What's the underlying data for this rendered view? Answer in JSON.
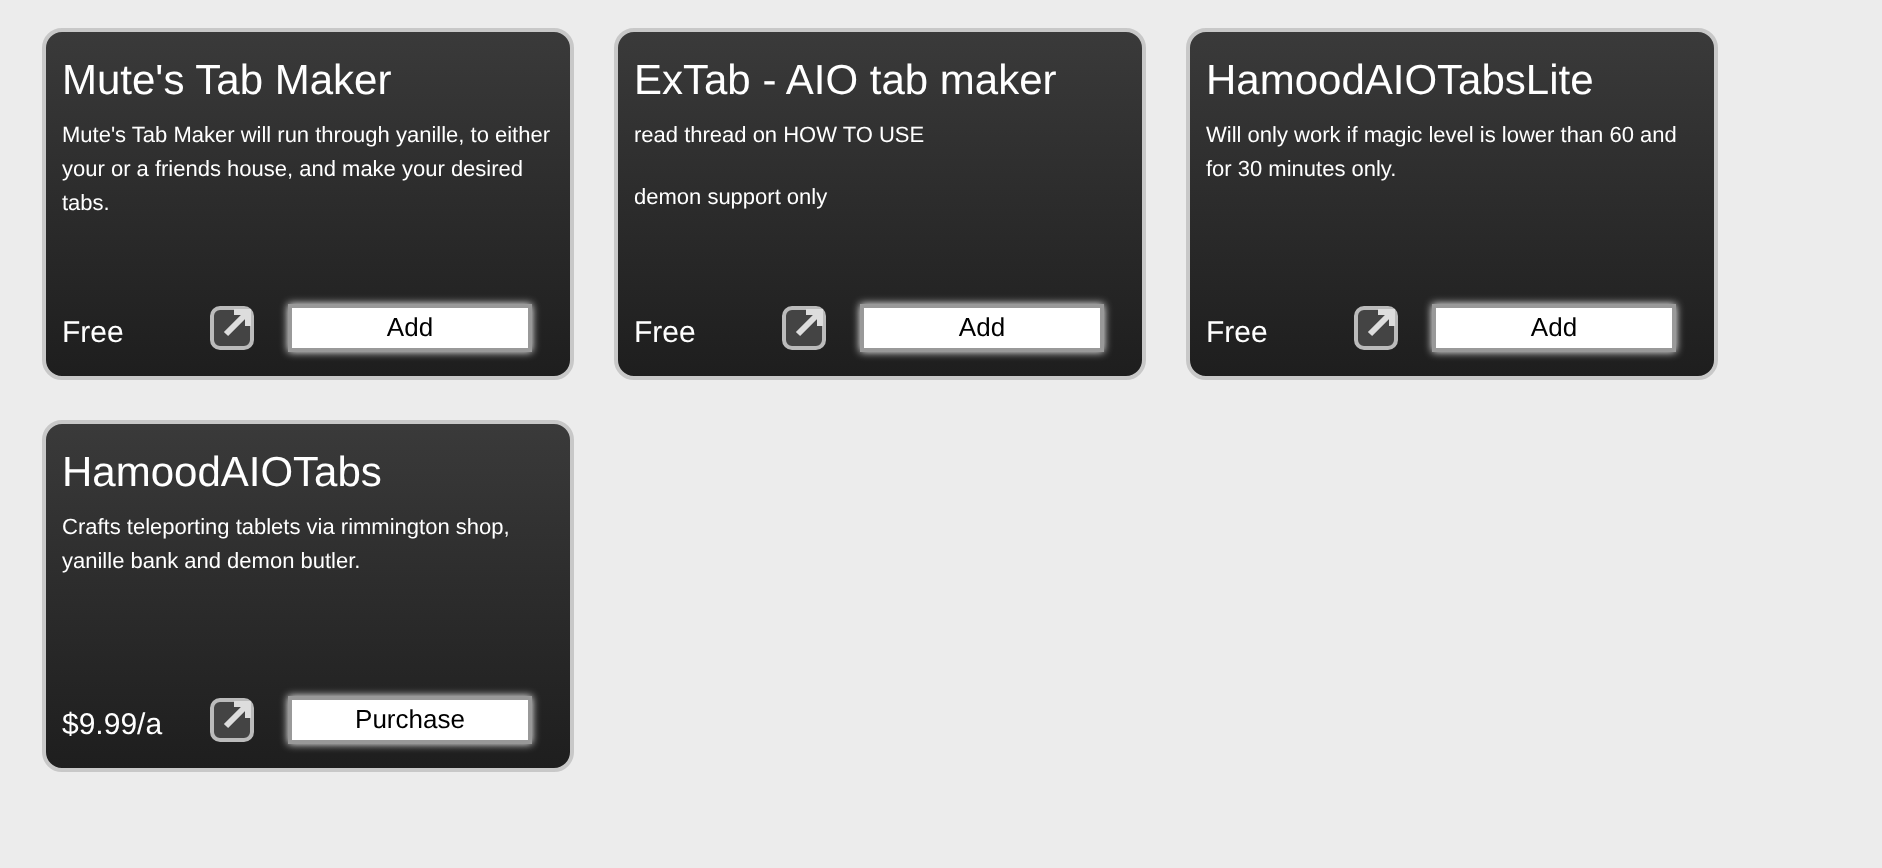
{
  "cards": [
    {
      "title": "Mute's Tab Maker",
      "description": [
        "Mute's Tab Maker will run through yanille, to either your or a friends house, and make your desired tabs."
      ],
      "price": "Free",
      "button": "Add"
    },
    {
      "title": "ExTab - AIO tab maker",
      "description": [
        "read thread on HOW TO USE",
        "demon support only"
      ],
      "price": "Free",
      "button": "Add"
    },
    {
      "title": "HamoodAIOTabsLite",
      "description": [
        "Will only work if magic level is lower than 60 and for 30 minutes only."
      ],
      "price": "Free",
      "button": "Add"
    },
    {
      "title": "HamoodAIOTabs",
      "description": [
        "Crafts teleporting tablets via rimmington shop, yanille bank and demon butler."
      ],
      "price": "$9.99/a",
      "button": "Purchase"
    }
  ]
}
